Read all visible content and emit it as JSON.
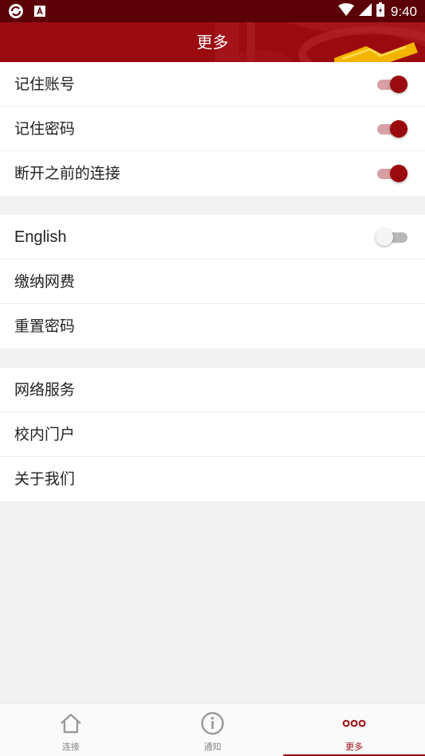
{
  "status_bar": {
    "time": "9:40"
  },
  "app_bar": {
    "title": "更多"
  },
  "groups": [
    {
      "items": [
        {
          "label": "记住账号",
          "toggle": true
        },
        {
          "label": "记住密码",
          "toggle": true
        },
        {
          "label": "断开之前的连接",
          "toggle": true
        }
      ]
    },
    {
      "items": [
        {
          "label": "English",
          "toggle": false
        },
        {
          "label": "缴纳网费"
        },
        {
          "label": "重置密码"
        }
      ]
    },
    {
      "items": [
        {
          "label": "网络服务"
        },
        {
          "label": "校内门户"
        },
        {
          "label": "关于我们"
        }
      ]
    }
  ],
  "bottom_nav": {
    "tabs": [
      {
        "label": "连接",
        "icon": "home-icon"
      },
      {
        "label": "通知",
        "icon": "info-icon"
      },
      {
        "label": "更多",
        "icon": "more-icon",
        "active": true
      }
    ]
  },
  "colors": {
    "primary": "#9b0a0f",
    "status_bar": "#5a0006"
  }
}
